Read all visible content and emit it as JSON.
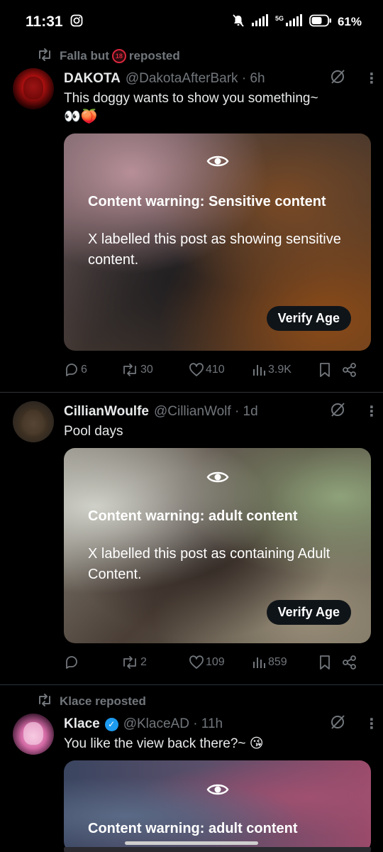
{
  "status_bar": {
    "time": "11:31",
    "network": "5G",
    "battery": "61%"
  },
  "feed": {
    "posts": [
      {
        "repost_prefix": "Falla but",
        "repost_badge": "18",
        "repost_suffix": "reposted",
        "name": "DAKOTA",
        "handle": "@DakotaAfterBark · 6h",
        "text_line1": "This doggy wants to show you something~",
        "text_line2": "👀🍑",
        "warning_title": "Content warning: Sensitive content",
        "warning_text": "X labelled this post as showing sensitive content.",
        "verify_label": "Verify Age",
        "replies": "6",
        "reposts": "30",
        "likes": "410",
        "views": "3.9K"
      },
      {
        "name": "CillianWoulfe",
        "handle": "@CillianWolf · 1d",
        "text_line1": "Pool days",
        "warning_title": "Content warning: adult content",
        "warning_text": "X labelled this post as containing Adult Content.",
        "verify_label": "Verify Age",
        "replies": "",
        "reposts": "2",
        "likes": "109",
        "views": "859"
      },
      {
        "repost_text": "Klace reposted",
        "name": "Klace",
        "handle": "@KlaceAD · 11h",
        "text_line1": "You like the view back there?~ 😘",
        "warning_title": "Content warning: adult content"
      }
    ]
  }
}
